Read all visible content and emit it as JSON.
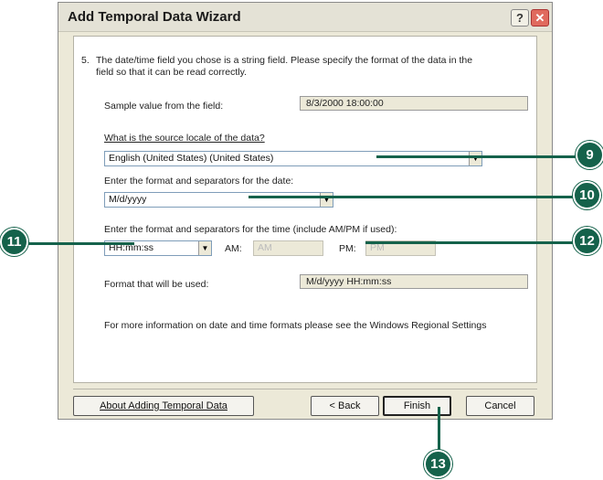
{
  "window": {
    "title": "Add Temporal Data Wizard",
    "help_label": "?",
    "close_label": "✕"
  },
  "step": {
    "number": "5.",
    "instruction_line1": "The date/time field you chose is a string field.  Please specify the format of the data in the",
    "instruction_line2": "field so that it can be read correctly."
  },
  "sample": {
    "label": "Sample value from the field:",
    "value": "8/3/2000 18:00:00"
  },
  "locale": {
    "label": "What is the source locale of the data?",
    "value": "English (United States) (United States)"
  },
  "date_format": {
    "label": "Enter the format and separators for the date:",
    "value": "M/d/yyyy"
  },
  "time_format": {
    "label": "Enter the format and separators for the time (include AM/PM if used):",
    "value": "HH:mm:ss",
    "am_label": "AM:",
    "am_value": "AM",
    "pm_label": "PM:",
    "pm_value": "PM"
  },
  "result": {
    "label": "Format that will be used:",
    "value": "M/d/yyyy HH:mm:ss"
  },
  "info_text": "For more information on date and time formats please see the Windows Regional Settings",
  "buttons": {
    "about": "About Adding Temporal Data",
    "back": "< Back",
    "finish": "Finish",
    "cancel": "Cancel"
  },
  "callouts": {
    "c9": "9",
    "c10": "10",
    "c11": "11",
    "c12": "12",
    "c13": "13"
  },
  "colors": {
    "callout": "#15624b",
    "dialog_bg": "#ece9d8"
  }
}
